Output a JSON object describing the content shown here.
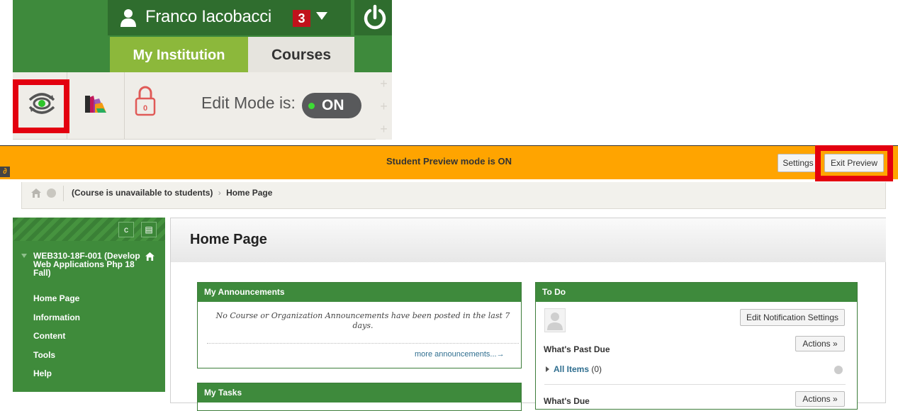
{
  "header": {
    "user_name": "Franco Iacobacci",
    "notification_count": "3",
    "tabs": [
      "My Institution",
      "Courses"
    ]
  },
  "toolbar": {
    "edit_mode_label": "Edit Mode is:",
    "edit_mode_value": "ON",
    "lock_count": "0"
  },
  "preview_bar": {
    "message": "Student Preview mode is ON",
    "settings_label": "Settings",
    "exit_label": "Exit Preview",
    "color": "#ffa400"
  },
  "breadcrumb": {
    "items": [
      "(Course is unavailable to students)",
      "Home Page"
    ],
    "separator": "›"
  },
  "course_menu": {
    "course_name": "WEB310-18F-001 (Develop Web Applications Php 18 Fall)",
    "items": [
      "Home Page",
      "Information",
      "Content",
      "Tools",
      "Help"
    ],
    "refresh_icon": "c",
    "folder_icon": "▤"
  },
  "main": {
    "page_title": "Home Page",
    "announcements": {
      "title": "My Announcements",
      "empty_text": "No Course or Organization Announcements have been posted in the last 7 days.",
      "more_link": "more announcements...→"
    },
    "tasks": {
      "title": "My Tasks"
    },
    "todo": {
      "title": "To Do",
      "edit_notifications": "Edit Notification Settings",
      "past_due_label": "What's Past Due",
      "due_label": "What's Due",
      "actions_label": "Actions »",
      "all_items": "All Items",
      "all_items_count": "(0)"
    }
  },
  "colors": {
    "bb_green": "#3e8a3c",
    "institution_tab": "#8cb83b",
    "highlight_red": "#e3000f"
  }
}
